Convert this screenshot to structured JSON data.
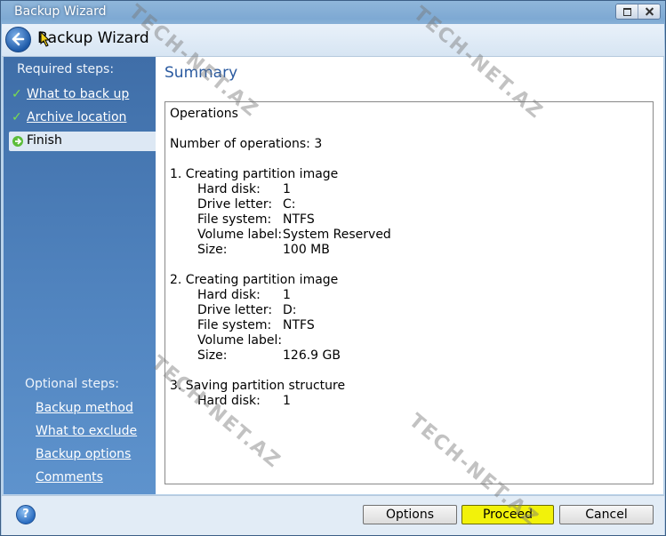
{
  "window": {
    "title": "Backup Wizard"
  },
  "header": {
    "title": "Backup Wizard"
  },
  "sidebar": {
    "required_heading": "Required steps:",
    "required_items": [
      {
        "label": "What to back up",
        "status": "done"
      },
      {
        "label": "Archive location",
        "status": "done"
      },
      {
        "label": "Finish",
        "status": "current"
      }
    ],
    "optional_heading": "Optional steps:",
    "optional_items": [
      {
        "label": "Backup method"
      },
      {
        "label": "What to exclude"
      },
      {
        "label": "Backup options"
      },
      {
        "label": "Comments"
      }
    ]
  },
  "main": {
    "title": "Summary",
    "operations_heading": "Operations",
    "count_line": "Number of operations: 3",
    "op1": {
      "title": "1. Creating partition image",
      "rows": [
        {
          "label": "Hard disk:",
          "value": "1"
        },
        {
          "label": "Drive letter:",
          "value": "C:"
        },
        {
          "label": "File system:",
          "value": "NTFS"
        },
        {
          "label": "Volume label:",
          "value": "System Reserved"
        },
        {
          "label": "Size:",
          "value": "100 MB"
        }
      ]
    },
    "op2": {
      "title": "2. Creating partition image",
      "rows": [
        {
          "label": "Hard disk:",
          "value": "1"
        },
        {
          "label": "Drive letter:",
          "value": "D:"
        },
        {
          "label": "File system:",
          "value": "NTFS"
        },
        {
          "label": "Volume label:",
          "value": ""
        },
        {
          "label": "Size:",
          "value": "126.9 GB"
        }
      ]
    },
    "op3": {
      "title": "3. Saving partition structure",
      "rows": [
        {
          "label": "Hard disk:",
          "value": "1"
        }
      ]
    }
  },
  "footer": {
    "options_label": "Options",
    "proceed_label": "Proceed",
    "cancel_label": "Cancel"
  },
  "watermark": "TECH-NET.AZ",
  "colors": {
    "accent": "#2a5aa0",
    "sidebar": "#4f82bd",
    "highlight": "#f2f20a",
    "check": "#7be04c"
  }
}
